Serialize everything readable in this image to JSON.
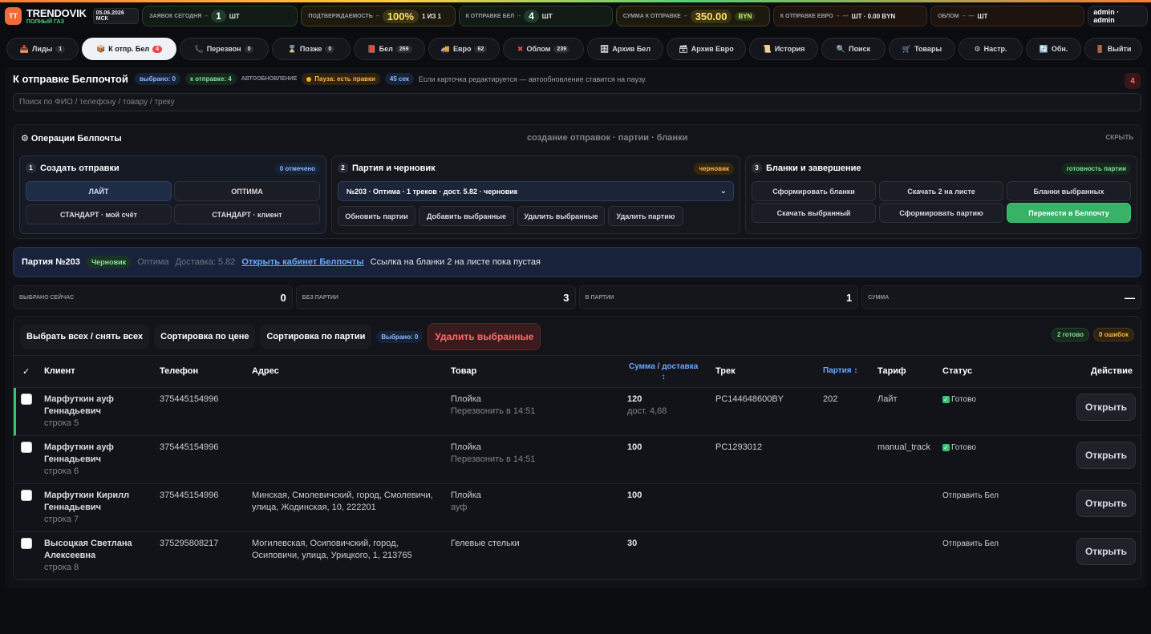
{
  "brand": {
    "logo": "TT",
    "name": "TRENDOVIK",
    "sub": "ПОЛНЫЙ ГАЗ",
    "date": "05.06.2026 МСК"
  },
  "stats_top": [
    {
      "label": "ЗАЯВОК СЕГОДНЯ",
      "value": "1",
      "unit": "шт"
    },
    {
      "label": "ПОДТВЕРЖДАЕМОСТЬ",
      "value": "100%",
      "unit": "1 из 1"
    },
    {
      "label": "К ОТПРАВКЕ БЕЛ",
      "value": "4",
      "unit": "шт"
    },
    {
      "label": "СУММА К ОТПРАВКЕ",
      "value": "350.00",
      "unit": "BYN"
    },
    {
      "label": "К ОТПРАВКЕ ЕВРО",
      "value": "—",
      "unit": "шт · 0.00 BYN"
    },
    {
      "label": "ОБЛОМ",
      "value": "—",
      "unit": "шт"
    }
  ],
  "user": "admin · admin",
  "tabs": [
    {
      "icon": "📥",
      "label": "Лиды",
      "count": "1"
    },
    {
      "icon": "📦",
      "label": "К отпр. Бел",
      "count": "4"
    },
    {
      "icon": "📞",
      "label": "Перезвон",
      "count": "0"
    },
    {
      "icon": "⌛",
      "label": "Позже",
      "count": "0"
    },
    {
      "icon": "📕",
      "label": "Бел",
      "count": "269"
    },
    {
      "icon": "🚚",
      "label": "Евро",
      "count": "62"
    },
    {
      "icon": "✖",
      "label": "Облом",
      "count": "239"
    },
    {
      "icon": "🗄",
      "label": "Архив Бел",
      "count": ""
    },
    {
      "icon": "🗃",
      "label": "Архив Евро",
      "count": ""
    },
    {
      "icon": "📜",
      "label": "История",
      "count": ""
    },
    {
      "icon": "🔍",
      "label": "Поиск",
      "count": ""
    },
    {
      "icon": "🛒",
      "label": "Товары",
      "count": ""
    },
    {
      "icon": "⚙",
      "label": "Настр.",
      "count": ""
    },
    {
      "icon": "🔄",
      "label": "Обн.",
      "count": ""
    },
    {
      "icon": "🚪",
      "label": "Выйти",
      "count": ""
    }
  ],
  "header": {
    "title": "К отправке Белпочтой",
    "selected": "выбрано: 0",
    "to_send": "к отправке: 4",
    "autoupdate": "АВТООБНОВЛЕНИЕ",
    "pause": "Пауза: есть правки",
    "timer": "45 сек",
    "hint": "Если карточка редактируется — автообновление ставится на паузу.",
    "badge": "4"
  },
  "search": {
    "placeholder": "Поиск по ФИО / телефону / товару / треку",
    "value": ""
  },
  "ops": {
    "title": "Операции Белпочты",
    "subtitle": "создание отправок · партии · бланки",
    "hide": "СКРЫТЬ",
    "card1": {
      "num": "1",
      "title": "Создать отправки",
      "chip": "0 отмечено",
      "buttons": [
        "ЛАЙТ",
        "ОПТИМА",
        "СТАНДАРТ · мой счёт",
        "СТАНДАРТ · клиент"
      ]
    },
    "card2": {
      "num": "2",
      "title": "Партия и черновик",
      "chip": "черновик",
      "select": "№203 · Оптима · 1 треков · дост. 5.82 · черновик",
      "buttons": [
        "Обновить партии",
        "Добавить выбранные",
        "Удалить выбранные",
        "Удалить партию"
      ]
    },
    "card3": {
      "num": "3",
      "title": "Бланки и завершение",
      "chip": "готовность партии",
      "buttons": [
        "Сформировать бланки",
        "Скачать 2 на листе",
        "Бланки выбранных",
        "Скачать выбранный",
        "Сформировать партию",
        "Перенести в Белпочту"
      ]
    }
  },
  "party": {
    "label": "Партия №203",
    "status": "Черновик",
    "tariff": "Оптима",
    "delivery": "Доставка: 5.82",
    "link": "Открыть кабинет Белпочты",
    "note": "Ссылка на бланки 2 на листе пока пустая"
  },
  "summary": [
    {
      "label": "ВЫБРАНО СЕЙЧАС",
      "value": "0"
    },
    {
      "label": "БЕЗ ПАРТИИ",
      "value": "3"
    },
    {
      "label": "В ПАРТИИ",
      "value": "1"
    },
    {
      "label": "СУММА",
      "value": "—"
    }
  ],
  "toolbar": {
    "select_all": "Выбрать всех / снять всех",
    "sort_price": "Сортировка по цене",
    "sort_party": "Сортировка по партии",
    "selected": "Выбрано: 0",
    "delete": "Удалить выбранные",
    "ready": "2 готово",
    "errors": "0 ошибок"
  },
  "table": {
    "headers": {
      "check": "✓",
      "client": "Клиент",
      "phone": "Телефон",
      "address": "Адрес",
      "product": "Товар",
      "sum": "Сумма / доставка",
      "sum_arrow": "↕",
      "track": "Трек",
      "party": "Партия ↕",
      "tariff": "Тариф",
      "status": "Статус",
      "action": "Действие"
    },
    "rows": [
      {
        "name": "Марфуткин ауф Геннадьевич",
        "row": "строка 5",
        "phone": "375445154996",
        "address": "",
        "product": "Плойка",
        "product_note": "Перезвонить в 14:51",
        "sum": "120",
        "delivery": "дост. 4,68",
        "track": "PC144648600BY",
        "party": "202",
        "tariff": "Лайт",
        "status": "Готово",
        "action": "Открыть"
      },
      {
        "name": "Марфуткин ауф Геннадьевич",
        "row": "строка 6",
        "phone": "375445154996",
        "address": "",
        "product": "Плойка",
        "product_note": "Перезвонить в 14:51",
        "sum": "100",
        "delivery": "",
        "track": "PC1293012",
        "party": "",
        "tariff": "manual_track",
        "status": "Готово",
        "action": "Открыть"
      },
      {
        "name": "Марфуткин Кирилл Геннадьевич",
        "row": "строка 7",
        "phone": "375445154996",
        "address": "Минская, Смолевичский, город, Смолевичи, улица, Жодинская, 10, 222201",
        "product": "Плойка",
        "product_note": "ауф",
        "sum": "100",
        "delivery": "",
        "track": "",
        "party": "",
        "tariff": "",
        "status": "Отправить Бел",
        "action": "Открыть"
      },
      {
        "name": "Высоцкая Светлана Алексеевна",
        "row": "строка 8",
        "phone": "375295808217",
        "address": "Могилевская, Осиповичский, город, Осиповичи, улица, Урицкого, 1, 213765",
        "product": "Гелевые стельки",
        "product_note": "",
        "sum": "30",
        "delivery": "",
        "track": "",
        "party": "",
        "tariff": "",
        "status": "Отправить Бел",
        "action": "Открыть"
      }
    ]
  }
}
